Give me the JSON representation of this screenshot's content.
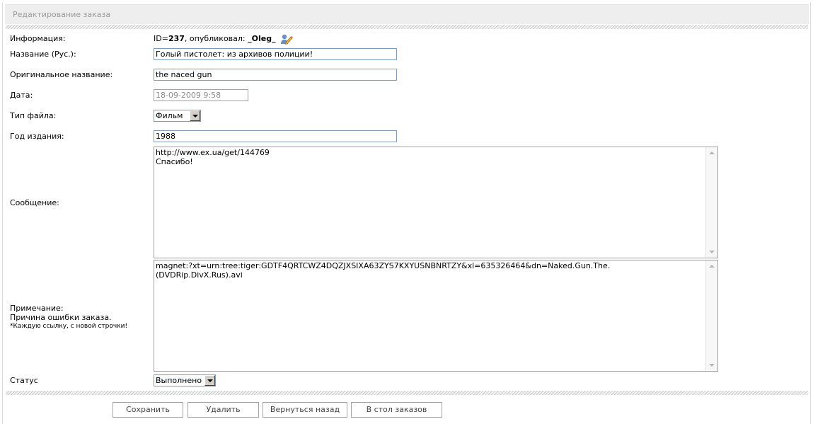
{
  "header": {
    "title": "Редактирование заказа"
  },
  "form": {
    "info": {
      "label": "Информация:",
      "id_prefix": "ID=",
      "id_value": "237",
      "published_by": ", опубликовал: ",
      "author": "_Oleg_"
    },
    "title_ru": {
      "label": "Название (Рус.):",
      "value": "Голый пистолет: из архивов полиции!"
    },
    "original_title": {
      "label": "Оригинальное название:",
      "value": "the naced gun"
    },
    "date": {
      "label": "Дата:",
      "value": "18-09-2009 9:58"
    },
    "file_type": {
      "label": "Тип файла:",
      "selected": "Фильм"
    },
    "year": {
      "label": "Год издания:",
      "value": "1988"
    },
    "message": {
      "label": "Сообщение:",
      "value": "http://www.ex.ua/get/144769\nСпасибо!"
    },
    "note": {
      "label": "Примечание:",
      "reason": "Причина ошибки заказа.",
      "hint": "*Каждую ссылку, с новой строчки!",
      "value": "magnet:?xt=urn:tree:tiger:GDTF4QRTCWZ4DQZJXSIXA63ZYS7KXYUSNBNRTZY&xl=635326464&dn=Naked.Gun.The.\n(DVDRip.DivX.Rus).avi"
    },
    "status": {
      "label": "Статус",
      "selected": "Выполнено"
    }
  },
  "buttons": {
    "save": "Сохранить",
    "delete": "Удалить",
    "back": "Вернуться назад",
    "orders": "В стол заказов"
  },
  "colors": {
    "header_bg": "#eeeeee",
    "field_border": "#7f9db9"
  },
  "icons": {
    "edit_user": "edit-user-icon"
  }
}
